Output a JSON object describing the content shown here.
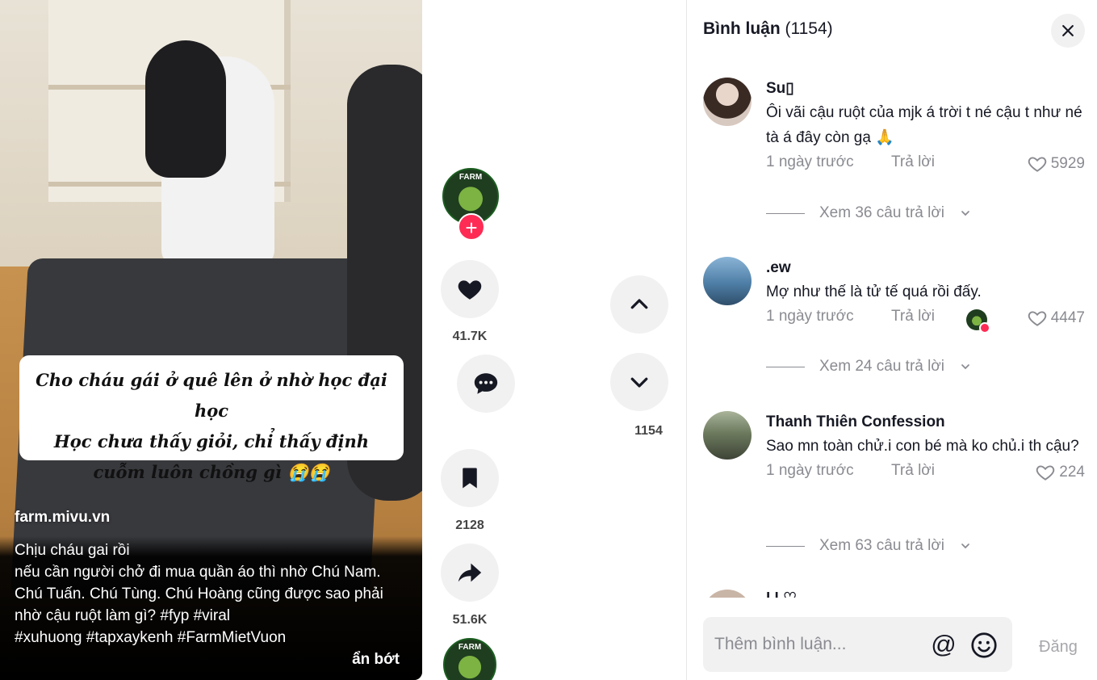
{
  "video": {
    "caption_lines": [
      "Cho cháu gái ở quê lên ở nhờ học đại học",
      "Học chưa thấy giỏi, chỉ thấy định",
      "cuỗm luôn chồng gì 😭😭"
    ],
    "watermark": "farm.mivu.vn",
    "description": "Chịu cháu gai rồi\n nếu cần người chở đi mua quần áo thì nhờ Chú Nam. Chú Tuấn. Chú Tùng. Chú Hoàng cũng được sao phải nhờ cậu ruột làm gì? #fyp  #viral\n#xuhuong  #tapxaykenh  #FarmMietVuon",
    "see_less": "ẩn bớt"
  },
  "creator": {
    "avatar_text": "FARM"
  },
  "actions": {
    "likes": "41.7K",
    "comments": "1154",
    "saves": "2128",
    "shares": "51.6K"
  },
  "comments_panel": {
    "title": "Bình luận",
    "count": "(1154)",
    "items": [
      {
        "user": "Su​▯",
        "text": "Ôi vãi cậu ruột của mjk á trời t né cậu t như né tà á đây còn gạ 🙏",
        "date": "1 ngày trước",
        "reply": "Trả lời",
        "likes": "5929",
        "more": "Xem 36 câu trả lời"
      },
      {
        "user": ".ew",
        "text": "Mợ như thế là tử tế quá rồi đấy.",
        "date": "1 ngày trước",
        "reply": "Trả lời",
        "likes": "4447",
        "more": "Xem 24 câu trả lời"
      },
      {
        "user": "Thanh Thiên Confession",
        "text": "Sao mn toàn chử.i con bé mà ko chủ.i th cậu?",
        "date": "1 ngày trước",
        "reply": "Trả lời",
        "likes": "224",
        "more": "Xem 63 câu trả lời"
      }
    ],
    "partial_user": "l.l.♡",
    "input_placeholder": "Thêm bình luận...",
    "input_value": "",
    "at_symbol": "@",
    "post_label": "Đăng"
  },
  "colors": {
    "accent": "#fe2c55",
    "text": "#161823",
    "muted": "#8a8b91",
    "button_bg": "#f1f1f2"
  }
}
